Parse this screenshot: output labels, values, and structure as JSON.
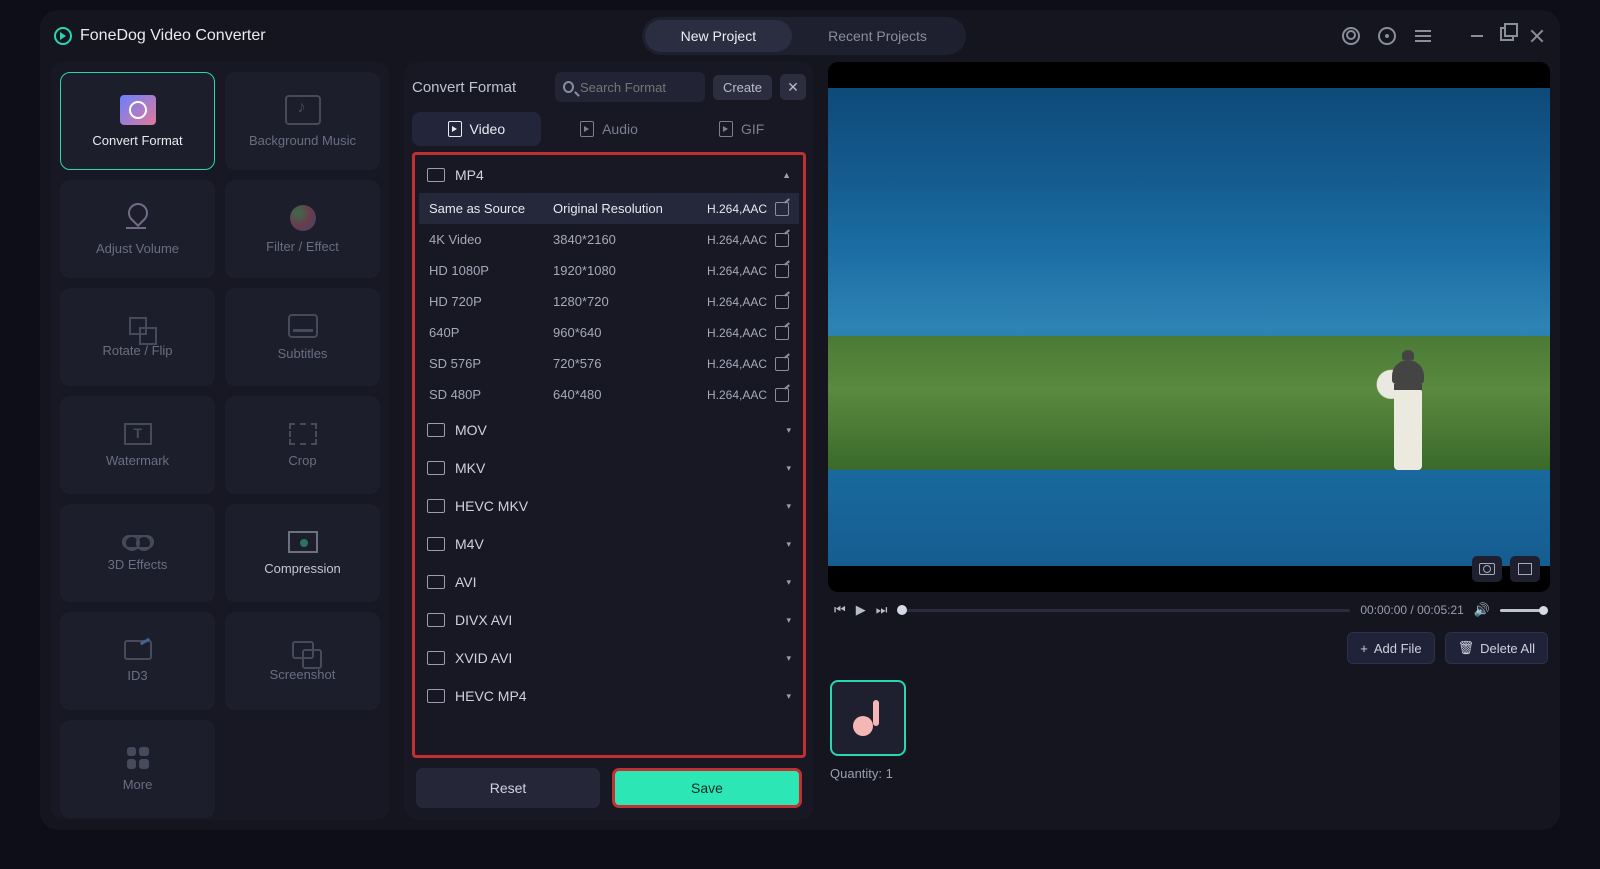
{
  "app": {
    "title": "FoneDog Video Converter"
  },
  "topTabs": {
    "new": "New Project",
    "recent": "Recent Projects"
  },
  "tools": [
    {
      "id": "convert-format",
      "label": "Convert Format",
      "active": true
    },
    {
      "id": "background-music",
      "label": "Background Music"
    },
    {
      "id": "adjust-volume",
      "label": "Adjust Volume"
    },
    {
      "id": "filter-effect",
      "label": "Filter / Effect"
    },
    {
      "id": "rotate-flip",
      "label": "Rotate / Flip"
    },
    {
      "id": "subtitles",
      "label": "Subtitles"
    },
    {
      "id": "watermark",
      "label": "Watermark"
    },
    {
      "id": "crop",
      "label": "Crop"
    },
    {
      "id": "3d-effects",
      "label": "3D Effects"
    },
    {
      "id": "compression",
      "label": "Compression"
    },
    {
      "id": "id3",
      "label": "ID3"
    },
    {
      "id": "screenshot",
      "label": "Screenshot"
    },
    {
      "id": "more",
      "label": "More"
    }
  ],
  "formatPanel": {
    "title": "Convert Format",
    "searchPlaceholder": "Search Format",
    "createLabel": "Create",
    "tabs": {
      "video": "Video",
      "audio": "Audio",
      "gif": "GIF"
    },
    "resetLabel": "Reset",
    "saveLabel": "Save"
  },
  "formats": {
    "expanded": {
      "name": "MP4",
      "rows": [
        {
          "name": "Same as Source",
          "res": "Original Resolution",
          "codec": "H.264,AAC",
          "selected": true
        },
        {
          "name": "4K Video",
          "res": "3840*2160",
          "codec": "H.264,AAC"
        },
        {
          "name": "HD 1080P",
          "res": "1920*1080",
          "codec": "H.264,AAC"
        },
        {
          "name": "HD 720P",
          "res": "1280*720",
          "codec": "H.264,AAC"
        },
        {
          "name": "640P",
          "res": "960*640",
          "codec": "H.264,AAC"
        },
        {
          "name": "SD 576P",
          "res": "720*576",
          "codec": "H.264,AAC"
        },
        {
          "name": "SD 480P",
          "res": "640*480",
          "codec": "H.264,AAC"
        }
      ]
    },
    "collapsed": [
      "MOV",
      "MKV",
      "HEVC MKV",
      "M4V",
      "AVI",
      "DIVX AVI",
      "XVID AVI",
      "HEVC MP4"
    ]
  },
  "player": {
    "time": "00:00:00 / 00:05:21"
  },
  "fileBar": {
    "add": "Add File",
    "deleteAll": "Delete All",
    "quantity": "Quantity: 1"
  }
}
